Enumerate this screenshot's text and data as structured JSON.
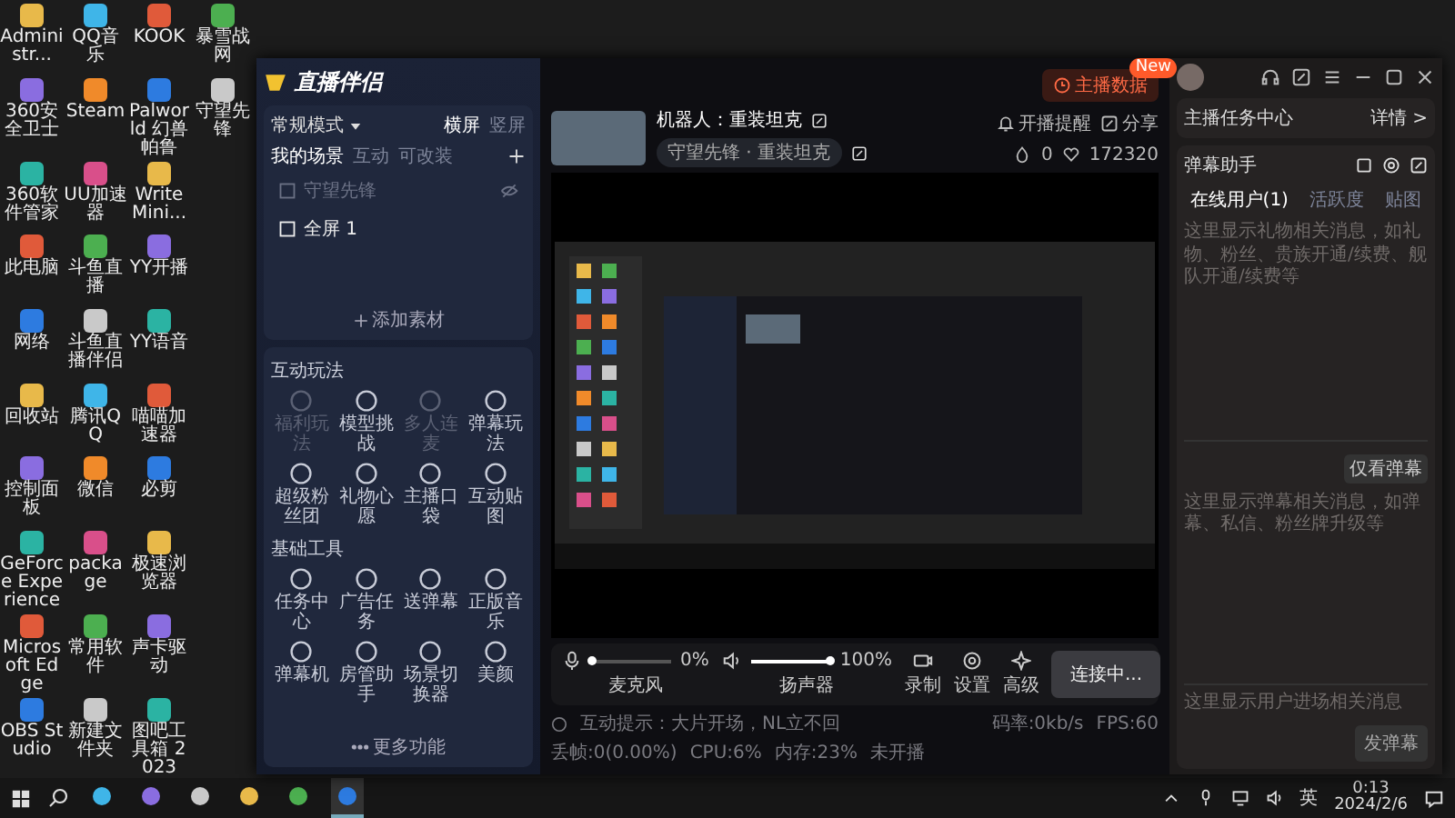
{
  "desktop_rows": [
    [
      "Administr...",
      "QQ音乐",
      "KOOK",
      "暴雪战网"
    ],
    [
      "360安全卫士",
      "Steam",
      "Palworld 幻兽帕鲁",
      "守望先锋"
    ],
    [
      "360软件管家",
      "UU加速器",
      "WriteMini..."
    ],
    [
      "此电脑",
      "斗鱼直播",
      "YY开播"
    ],
    [
      "网络",
      "斗鱼直播伴侣",
      "YY语音"
    ],
    [
      "回收站",
      "腾讯QQ",
      "喵喵加速器"
    ],
    [
      "控制面板",
      "微信",
      "必剪"
    ],
    [
      "GeForce Experience",
      "package",
      "极速浏览器"
    ],
    [
      "Microsoft Edge",
      "常用软件",
      "声卡驱动"
    ],
    [
      "OBS Studio",
      "新建文件夹",
      "图吧工具箱 2023"
    ]
  ],
  "window": {
    "logo": "直播伴侣",
    "mode": "常规模式",
    "orientation_tabs": [
      {
        "label": "横屏",
        "selected": true
      },
      {
        "label": "竖屏",
        "selected": false
      }
    ],
    "scene_tabs": [
      {
        "label": "我的场景",
        "selected": true
      },
      {
        "label": "互动",
        "selected": false
      },
      {
        "label": "可改装",
        "selected": false
      }
    ],
    "scenes": [
      {
        "label": "守望先锋",
        "hidden": true
      },
      {
        "label": "全屏 1",
        "hidden": false
      }
    ],
    "add_source": "添加素材",
    "interactive": {
      "title": "互动玩法",
      "items": [
        {
          "label": "福利玩法",
          "disabled": true
        },
        {
          "label": "模型挑战",
          "disabled": false
        },
        {
          "label": "多人连麦",
          "disabled": true
        },
        {
          "label": "弹幕玩法",
          "disabled": false
        },
        {
          "label": "超级粉丝团",
          "disabled": false
        },
        {
          "label": "礼物心愿",
          "disabled": false
        },
        {
          "label": "主播口袋",
          "disabled": false
        },
        {
          "label": "互动贴图",
          "disabled": false
        }
      ]
    },
    "tools": {
      "title": "基础工具",
      "items": [
        {
          "label": "任务中心",
          "disabled": false
        },
        {
          "label": "广告任务",
          "disabled": false
        },
        {
          "label": "送弹幕",
          "disabled": false
        },
        {
          "label": "正版音乐",
          "disabled": false
        },
        {
          "label": "弹幕机",
          "disabled": false
        },
        {
          "label": "房管助手",
          "disabled": false
        },
        {
          "label": "场景切换器",
          "disabled": false
        },
        {
          "label": "美颜",
          "disabled": false
        }
      ]
    },
    "more": "更多功能",
    "stream_data_button": "主播数据",
    "new_badge": "New",
    "stream_title": "机器人：重装坦克",
    "category": "守望先锋 · 重装坦克",
    "reminder": "开播提醒",
    "share": "分享",
    "likes": "0",
    "fans": "172320",
    "mic": {
      "label": "麦克风",
      "level": 0,
      "reading": "0%"
    },
    "speaker": {
      "label": "扬声器",
      "level": 1,
      "reading": "100%"
    },
    "actions": [
      "录制",
      "设置",
      "高级"
    ],
    "connect_button": "连接中...",
    "hint": "互动提示：大片开场，NL立不回",
    "stats": [
      "码率:0kb/s",
      "FPS:60",
      "丢帧:0(0.00%)",
      "CPU:6%",
      "内存:23%",
      "未开播"
    ],
    "task_center": "主播任务中心",
    "details": "详情 >",
    "danmu_title": "弹幕助手",
    "danmu_tabs": [
      {
        "label": "在线用户(1)",
        "selected": true
      },
      {
        "label": "活跃度",
        "selected": false
      },
      {
        "label": "贴图",
        "selected": false
      }
    ],
    "gift_hint": "这里显示礼物相关消息，如礼物、粉丝、贵族开通/续费、舰队开通/续费等",
    "comment_hint": "这里显示弹幕相关消息，如弹幕、私信、粉丝牌升级等",
    "filter_badge": "仅看弹幕",
    "input_placeholder": "这里显示用户进场相关消息",
    "send_button": "发弹幕"
  },
  "taskbar": {
    "apps": [
      {
        "selected": false
      },
      {
        "selected": false
      },
      {
        "selected": false
      },
      {
        "selected": false
      },
      {
        "selected": false
      },
      {
        "selected": true
      }
    ],
    "ime": "英",
    "time": "0:13",
    "date": "2024/2/6"
  }
}
